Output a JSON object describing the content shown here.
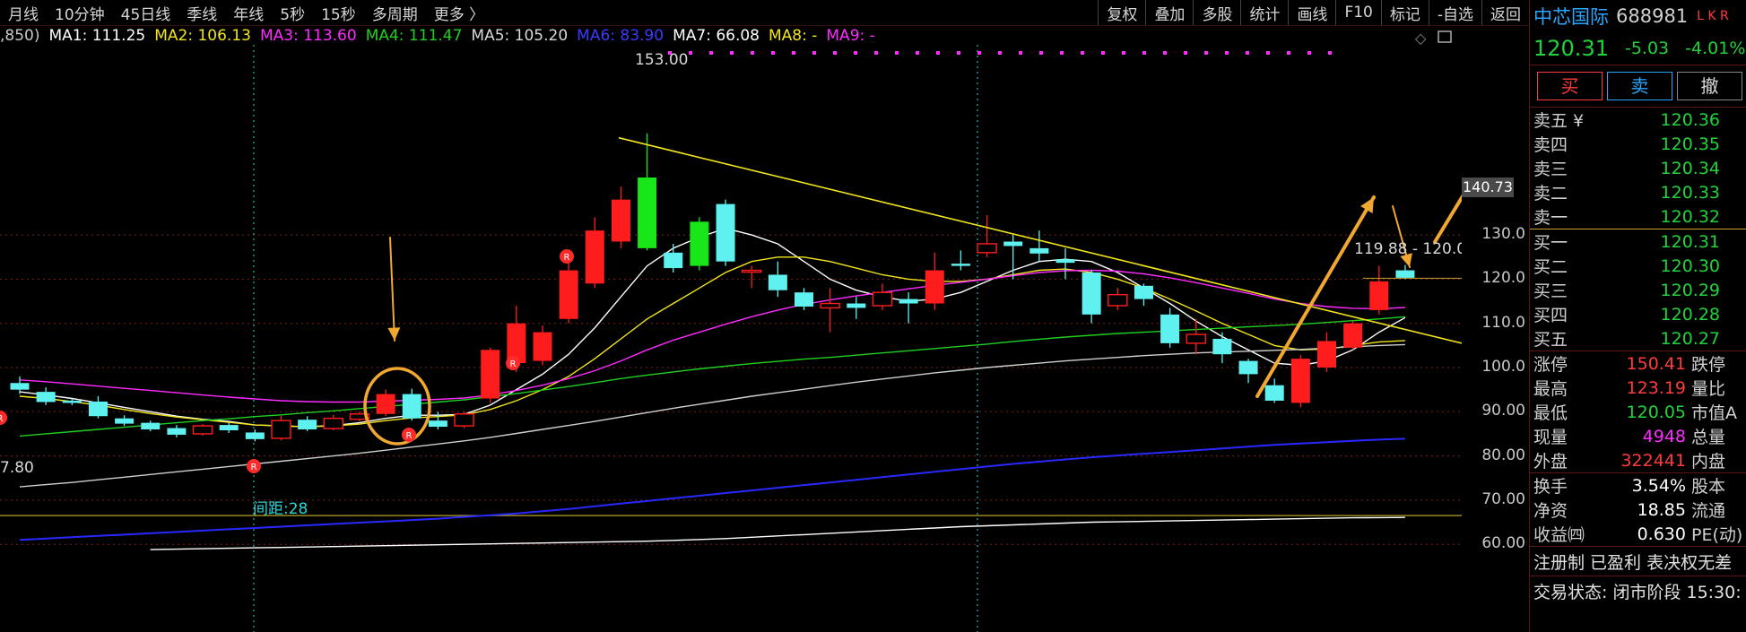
{
  "toolbar": {
    "periods": [
      "月线",
      "10分钟",
      "45日线",
      "季线",
      "年线",
      "5秒",
      "15秒",
      "多周期",
      "更多 〉"
    ],
    "tools": [
      "复权",
      "叠加",
      "多股",
      "统计",
      "画线",
      "F10",
      "标记",
      "-自选",
      "返回"
    ]
  },
  "legend": {
    "prefix": ",850)",
    "items": [
      {
        "label": "MA1: 111.25",
        "color": "#ffffff"
      },
      {
        "label": "MA2: 106.13",
        "color": "#f2e51c"
      },
      {
        "label": "MA3: 113.60",
        "color": "#ff2bff"
      },
      {
        "label": "MA4: 111.47",
        "color": "#20d020"
      },
      {
        "label": "MA5: 105.20",
        "color": "#d8d8d8"
      },
      {
        "label": "MA6: 83.90",
        "color": "#3a3aff"
      },
      {
        "label": "MA7: 66.08",
        "color": "#ffffff"
      },
      {
        "label": "MA8: -",
        "color": "#f2e51c"
      },
      {
        "label": "MA9: -",
        "color": "#ff2bff"
      }
    ]
  },
  "annotations": {
    "high_label": "153.00",
    "left_low_label": "7.80",
    "spacing_label": "间距:28",
    "range_label": "119.88 - 120.0",
    "axis_highlight": "140.73"
  },
  "chart_data": {
    "type": "candlestick",
    "y_ticks": [
      "130.0",
      "120.0",
      "110.0",
      "100.0",
      "90.00",
      "80.00",
      "70.00",
      "60.00"
    ],
    "ylim": [
      55,
      155
    ],
    "candles": [
      {
        "o": 96.5,
        "c": 95.0,
        "h": 98.0,
        "l": 94.0
      },
      {
        "o": 94.5,
        "c": 92.2,
        "h": 95.5,
        "l": 91.5
      },
      {
        "o": 92.5,
        "c": 92.0,
        "h": 93.0,
        "l": 91.5
      },
      {
        "o": 92.3,
        "c": 89.0,
        "h": 93.5,
        "l": 88.5
      },
      {
        "o": 88.5,
        "c": 87.3,
        "h": 89.2,
        "l": 86.8
      },
      {
        "o": 87.5,
        "c": 86.0,
        "h": 88.0,
        "l": 85.6
      },
      {
        "o": 86.3,
        "c": 84.8,
        "h": 87.0,
        "l": 84.2
      },
      {
        "o": 85.0,
        "c": 86.8,
        "h": 87.2,
        "l": 84.6
      },
      {
        "o": 87.0,
        "c": 85.8,
        "h": 87.5,
        "l": 85.2
      },
      {
        "o": 85.3,
        "c": 83.8,
        "h": 86.0,
        "l": 83.3
      },
      {
        "o": 84.0,
        "c": 88.0,
        "h": 89.0,
        "l": 83.5
      },
      {
        "o": 88.2,
        "c": 86.0,
        "h": 89.0,
        "l": 85.6
      },
      {
        "o": 86.2,
        "c": 88.5,
        "h": 89.3,
        "l": 85.8
      },
      {
        "o": 88.3,
        "c": 89.5,
        "h": 90.0,
        "l": 87.8
      },
      {
        "o": 89.5,
        "c": 94.0,
        "h": 95.0,
        "l": 89.0
      },
      {
        "o": 94.0,
        "c": 88.5,
        "h": 95.2,
        "l": 88.0
      },
      {
        "o": 88.0,
        "c": 86.6,
        "h": 90.0,
        "l": 86.0
      },
      {
        "o": 86.8,
        "c": 89.5,
        "h": 90.0,
        "l": 86.3
      },
      {
        "o": 93.0,
        "c": 104.0,
        "h": 104.5,
        "l": 92.0
      },
      {
        "o": 101.0,
        "c": 110.0,
        "h": 114.0,
        "l": 99.0
      },
      {
        "o": 101.5,
        "c": 108.0,
        "h": 109.5,
        "l": 100.5
      },
      {
        "o": 111.0,
        "c": 122.0,
        "h": 126.0,
        "l": 110.0
      },
      {
        "o": 119.0,
        "c": 131.0,
        "h": 134.0,
        "l": 118.0
      },
      {
        "o": 128.5,
        "c": 138.0,
        "h": 141.0,
        "l": 127.0
      },
      {
        "o": 127.0,
        "c": 143.0,
        "h": 153.0,
        "l": 126.5
      },
      {
        "o": 126.0,
        "c": 122.5,
        "h": 128.0,
        "l": 121.5
      },
      {
        "o": 123.0,
        "c": 133.0,
        "h": 134.0,
        "l": 122.0
      },
      {
        "o": 137.0,
        "c": 124.0,
        "h": 138.0,
        "l": 123.0
      },
      {
        "o": 122.0,
        "c": 122.0,
        "h": 123.0,
        "l": 118.0
      },
      {
        "o": 121.0,
        "c": 117.5,
        "h": 124.0,
        "l": 116.0
      },
      {
        "o": 117.0,
        "c": 113.8,
        "h": 118.0,
        "l": 113.0
      },
      {
        "o": 113.5,
        "c": 114.5,
        "h": 118.0,
        "l": 108.0
      },
      {
        "o": 114.5,
        "c": 113.5,
        "h": 116.0,
        "l": 111.0
      },
      {
        "o": 114.0,
        "c": 117.0,
        "h": 119.0,
        "l": 113.0
      },
      {
        "o": 115.5,
        "c": 114.5,
        "h": 117.0,
        "l": 110.0
      },
      {
        "o": 114.5,
        "c": 122.0,
        "h": 126.0,
        "l": 113.0
      },
      {
        "o": 123.5,
        "c": 123.0,
        "h": 126.5,
        "l": 122.0
      },
      {
        "o": 126.0,
        "c": 128.0,
        "h": 134.5,
        "l": 125.0
      },
      {
        "o": 128.5,
        "c": 127.5,
        "h": 130.0,
        "l": 120.0
      },
      {
        "o": 127.0,
        "c": 125.8,
        "h": 131.0,
        "l": 124.0
      },
      {
        "o": 124.5,
        "c": 123.7,
        "h": 127.0,
        "l": 120.0
      },
      {
        "o": 121.5,
        "c": 112.0,
        "h": 122.0,
        "l": 110.0
      },
      {
        "o": 114.0,
        "c": 116.5,
        "h": 118.0,
        "l": 113.0
      },
      {
        "o": 118.5,
        "c": 115.5,
        "h": 119.0,
        "l": 114.0
      },
      {
        "o": 112.0,
        "c": 105.5,
        "h": 113.5,
        "l": 104.5
      },
      {
        "o": 105.5,
        "c": 107.5,
        "h": 111.0,
        "l": 103.0
      },
      {
        "o": 106.5,
        "c": 103.0,
        "h": 108.0,
        "l": 101.0
      },
      {
        "o": 101.5,
        "c": 98.5,
        "h": 102.0,
        "l": 96.5
      },
      {
        "o": 96.0,
        "c": 92.5,
        "h": 97.5,
        "l": 92.0
      },
      {
        "o": 92.0,
        "c": 102.0,
        "h": 102.8,
        "l": 91.0
      },
      {
        "o": 100.0,
        "c": 106.0,
        "h": 108.0,
        "l": 99.0
      },
      {
        "o": 104.5,
        "c": 110.0,
        "h": 110.5,
        "l": 104.0
      },
      {
        "o": 113.0,
        "c": 119.5,
        "h": 123.0,
        "l": 112.0
      },
      {
        "o": 122.0,
        "c": 120.3,
        "h": 123.2,
        "l": 120.0
      }
    ],
    "series": [
      {
        "name": "MA1",
        "color": "#ffffff",
        "values": [
          94.5,
          93.8,
          93.0,
          92.0,
          91.0,
          90.0,
          89.0,
          88.3,
          87.8,
          87.0,
          86.8,
          86.6,
          86.9,
          87.5,
          88.5,
          89.2,
          89.2,
          89.4,
          91.5,
          95.0,
          98.5,
          103.0,
          109.0,
          116.0,
          123.0,
          127.0,
          129.5,
          131.5,
          130.0,
          128.0,
          124.0,
          120.0,
          117.5,
          116.0,
          115.0,
          115.5,
          117.0,
          119.5,
          122.0,
          124.0,
          124.5,
          124.0,
          121.5,
          118.0,
          114.5,
          110.5,
          107.0,
          104.0,
          101.0,
          100.5,
          101.5,
          104.0,
          108.0,
          111.3
        ]
      },
      {
        "name": "MA2",
        "color": "#f2e51c",
        "values": [
          93.5,
          93.0,
          92.3,
          91.5,
          90.5,
          89.6,
          88.8,
          88.2,
          87.6,
          87.0,
          86.8,
          86.6,
          86.8,
          87.2,
          88.0,
          88.6,
          88.9,
          89.3,
          90.5,
          92.5,
          95.0,
          98.0,
          102.0,
          106.5,
          111.0,
          114.5,
          118.0,
          121.5,
          124.0,
          125.0,
          125.0,
          124.0,
          122.5,
          121.0,
          120.0,
          119.5,
          119.5,
          120.0,
          121.0,
          122.0,
          122.3,
          121.5,
          120.0,
          118.0,
          115.5,
          112.8,
          110.0,
          107.5,
          105.0,
          104.0,
          104.2,
          105.0,
          105.8,
          106.1
        ]
      },
      {
        "name": "MA3",
        "color": "#ff2bff",
        "values": [
          97.2,
          96.8,
          96.3,
          95.8,
          95.3,
          94.8,
          94.3,
          93.8,
          93.3,
          92.9,
          92.5,
          92.3,
          92.2,
          92.2,
          92.4,
          92.6,
          92.8,
          93.1,
          93.8,
          94.8,
          96.0,
          97.5,
          99.3,
          101.5,
          104.0,
          106.2,
          108.0,
          109.8,
          111.5,
          113.0,
          114.3,
          115.3,
          116.2,
          117.0,
          117.8,
          118.6,
          119.3,
          120.0,
          120.8,
          121.5,
          121.9,
          122.0,
          121.8,
          121.2,
          120.3,
          119.2,
          118.0,
          116.8,
          115.5,
          114.5,
          113.8,
          113.4,
          113.3,
          113.6
        ]
      },
      {
        "name": "MA4",
        "color": "#20d020",
        "values": [
          84.5,
          85.0,
          85.5,
          86.0,
          86.5,
          87.0,
          87.5,
          88.0,
          88.4,
          88.9,
          89.3,
          89.8,
          90.2,
          90.7,
          91.2,
          91.7,
          92.2,
          92.7,
          93.4,
          94.1,
          94.9,
          95.7,
          96.6,
          97.5,
          98.3,
          99.0,
          99.7,
          100.3,
          100.9,
          101.4,
          101.9,
          102.3,
          102.8,
          103.3,
          103.8,
          104.3,
          104.8,
          105.3,
          105.9,
          106.4,
          106.9,
          107.3,
          107.7,
          108.0,
          108.3,
          108.6,
          108.9,
          109.2,
          109.5,
          109.8,
          110.2,
          110.6,
          111.0,
          111.5
        ]
      },
      {
        "name": "MA5",
        "color": "#cfcfcf",
        "values": [
          73.0,
          73.5,
          74.0,
          74.6,
          75.2,
          75.8,
          76.4,
          77.0,
          77.6,
          78.2,
          78.8,
          79.4,
          80.0,
          80.6,
          81.3,
          82.0,
          82.7,
          83.4,
          84.2,
          85.1,
          86.0,
          86.9,
          87.8,
          88.8,
          89.8,
          90.8,
          91.7,
          92.6,
          93.5,
          94.3,
          95.1,
          95.9,
          96.7,
          97.4,
          98.1,
          98.8,
          99.4,
          100.0,
          100.5,
          101.0,
          101.5,
          101.9,
          102.3,
          102.7,
          103.0,
          103.3,
          103.5,
          103.7,
          103.9,
          104.1,
          104.4,
          104.7,
          105.0,
          105.2
        ]
      },
      {
        "name": "MA6",
        "color": "#2828ff",
        "values": [
          61.0,
          61.3,
          61.6,
          61.9,
          62.2,
          62.5,
          62.8,
          63.1,
          63.4,
          63.7,
          64.0,
          64.3,
          64.6,
          64.9,
          65.2,
          65.5,
          65.8,
          66.2,
          66.6,
          67.0,
          67.5,
          68.0,
          68.6,
          69.2,
          69.8,
          70.4,
          71.0,
          71.6,
          72.2,
          72.8,
          73.4,
          74.0,
          74.6,
          75.2,
          75.8,
          76.4,
          77.0,
          77.6,
          78.2,
          78.7,
          79.2,
          79.7,
          80.1,
          80.5,
          80.9,
          81.3,
          81.7,
          82.1,
          82.5,
          82.8,
          83.1,
          83.4,
          83.7,
          83.9
        ]
      },
      {
        "name": "MA7",
        "color": "#ffffff",
        "values": [
          null,
          null,
          null,
          null,
          null,
          58.8,
          58.9,
          59.0,
          59.1,
          59.2,
          59.3,
          59.4,
          59.5,
          59.6,
          59.7,
          59.8,
          59.9,
          60.0,
          60.1,
          60.2,
          60.3,
          60.4,
          60.5,
          60.6,
          60.7,
          60.9,
          61.1,
          61.3,
          61.6,
          61.9,
          62.2,
          62.5,
          62.8,
          63.1,
          63.4,
          63.7,
          64.0,
          64.2,
          64.4,
          64.6,
          64.8,
          65.0,
          65.1,
          65.2,
          65.3,
          65.4,
          65.5,
          65.6,
          65.7,
          65.8,
          65.9,
          66.0,
          66.05,
          66.08
        ]
      }
    ]
  },
  "panel": {
    "name": "中芯国际",
    "code": "688981",
    "tags": "L K R",
    "price": "120.31",
    "change": "-5.03",
    "change_pct": "-4.01%",
    "buy_btn": "买",
    "sell_btn": "卖",
    "cancel_btn": "撤",
    "asks": [
      {
        "label": "卖五 ¥",
        "price": "120.36"
      },
      {
        "label": "卖四",
        "price": "120.35"
      },
      {
        "label": "卖三",
        "price": "120.34"
      },
      {
        "label": "卖二",
        "price": "120.33"
      },
      {
        "label": "卖一",
        "price": "120.32"
      }
    ],
    "bids": [
      {
        "label": "买一",
        "price": "120.31"
      },
      {
        "label": "买二",
        "price": "120.30"
      },
      {
        "label": "买三",
        "price": "120.29"
      },
      {
        "label": "买四",
        "price": "120.28"
      },
      {
        "label": "买五",
        "price": "120.27"
      }
    ],
    "stats": [
      {
        "l1": "涨停",
        "v1": "150.41",
        "c1": "red",
        "l2": "跌停"
      },
      {
        "l1": "最高",
        "v1": "123.19",
        "c1": "red",
        "l2": "量比"
      },
      {
        "l1": "最低",
        "v1": "120.05",
        "c1": "green",
        "l2": "市值A"
      },
      {
        "l1": "现量",
        "v1": "4948",
        "c1": "magenta",
        "l2": "总量"
      },
      {
        "l1": "外盘",
        "v1": "322441",
        "c1": "red",
        "l2": "内盘"
      }
    ],
    "stats2": [
      {
        "l1": "换手",
        "v1": "3.54%",
        "l2": "股本"
      },
      {
        "l1": "净资",
        "v1": "18.85",
        "l2": "流通"
      },
      {
        "l1": "收益㈣",
        "v1": "0.630",
        "l2": "PE(动)"
      }
    ],
    "footer1": "注册制 已盈利 表决权无差",
    "footer2": "交易状态: 闭市阶段 15:30:"
  }
}
